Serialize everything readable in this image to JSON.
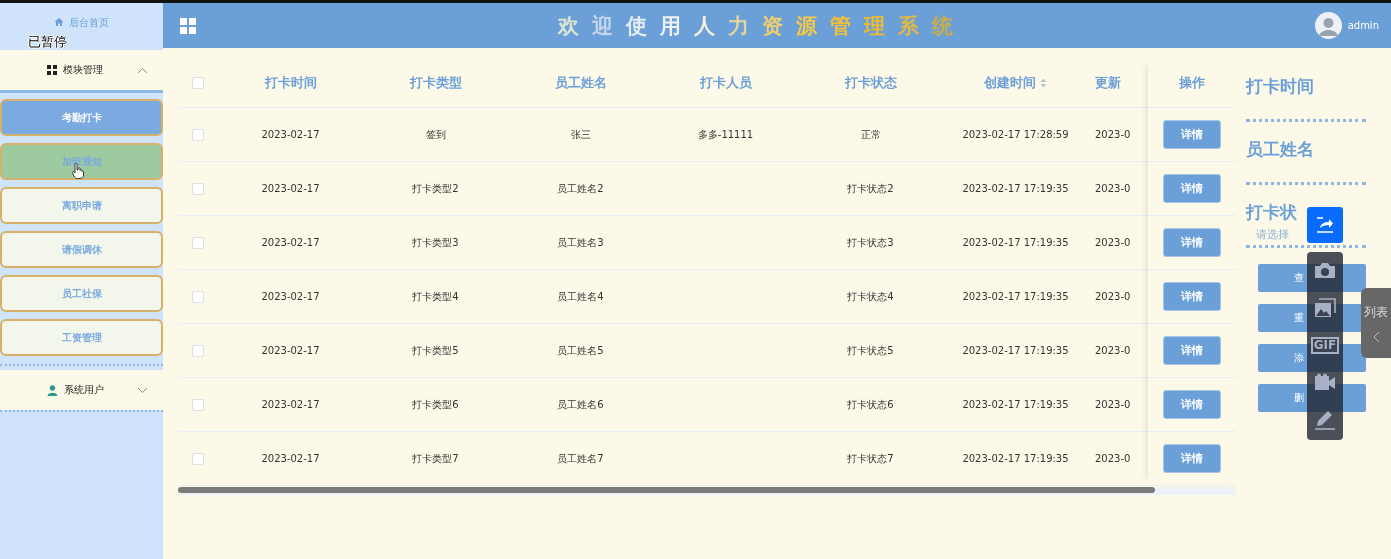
{
  "sidebar": {
    "home": "后台首页",
    "groups": [
      {
        "label": "模块管理",
        "expanded": true,
        "items": [
          {
            "label": "考勤打卡",
            "selected": true,
            "hovered": false
          },
          {
            "label": "加班通知",
            "selected": false,
            "hovered": true
          },
          {
            "label": "离职申请",
            "selected": false,
            "hovered": false
          },
          {
            "label": "请假调休",
            "selected": false,
            "hovered": false
          },
          {
            "label": "员工社保",
            "selected": false,
            "hovered": false
          },
          {
            "label": "工资管理",
            "selected": false,
            "hovered": false
          }
        ]
      },
      {
        "label": "系统用户",
        "expanded": false
      }
    ]
  },
  "header": {
    "title_chars": [
      {
        "char": "欢",
        "color": "#dbe4d4"
      },
      {
        "char": "迎",
        "color": "#c3d5ea"
      },
      {
        "char": "使",
        "color": "#e3ebf3"
      },
      {
        "char": "用",
        "color": "#eef2f5"
      },
      {
        "char": "人",
        "color": "#f2efe0"
      },
      {
        "char": "力",
        "color": "#e8d59a"
      },
      {
        "char": "资",
        "color": "#f0cf6a"
      },
      {
        "char": "源",
        "color": "#f4c64a"
      },
      {
        "char": "管",
        "color": "#f2bf3a"
      },
      {
        "char": "理",
        "color": "#eebc30"
      },
      {
        "char": "系",
        "color": "#e0b848"
      },
      {
        "char": "统",
        "color": "#c8ac50"
      }
    ],
    "user": "admin"
  },
  "table": {
    "header_checked": false,
    "columns": [
      {
        "label": "打卡时间"
      },
      {
        "label": "打卡类型"
      },
      {
        "label": "员工姓名"
      },
      {
        "label": "打卡人员"
      },
      {
        "label": "打卡状态"
      },
      {
        "label": "创建时间",
        "sortable": true
      },
      {
        "label": "更新"
      }
    ],
    "action_header": "操作",
    "rows": [
      {
        "checked": false,
        "cells": [
          "2023-02-17",
          "签到",
          "张三",
          "多多-11111",
          "正常",
          "2023-02-17 17:28:59",
          "2023-0"
        ],
        "action": "详情"
      },
      {
        "checked": false,
        "cells": [
          "2023-02-17",
          "打卡类型2",
          "员工姓名2",
          null,
          "打卡状态2",
          "2023-02-17 17:19:35",
          "2023-0"
        ],
        "action": "详情"
      },
      {
        "checked": false,
        "cells": [
          "2023-02-17",
          "打卡类型3",
          "员工姓名3",
          null,
          "打卡状态3",
          "2023-02-17 17:19:35",
          "2023-0"
        ],
        "action": "详情"
      },
      {
        "checked": false,
        "cells": [
          "2023-02-17",
          "打卡类型4",
          "员工姓名4",
          null,
          "打卡状态4",
          "2023-02-17 17:19:35",
          "2023-0"
        ],
        "action": "详情"
      },
      {
        "checked": false,
        "cells": [
          "2023-02-17",
          "打卡类型5",
          "员工姓名5",
          null,
          "打卡状态5",
          "2023-02-17 17:19:35",
          "2023-0"
        ],
        "action": "详情"
      },
      {
        "checked": false,
        "cells": [
          "2023-02-17",
          "打卡类型6",
          "员工姓名6",
          null,
          "打卡状态6",
          "2023-02-17 17:19:35",
          "2023-0"
        ],
        "action": "详情"
      },
      {
        "checked": false,
        "cells": [
          "2023-02-17",
          "打卡类型7",
          "员工姓名7",
          null,
          "打卡状态7",
          "2023-02-17 17:19:35",
          "2023-0"
        ],
        "action": "详情"
      }
    ]
  },
  "search": {
    "fields": [
      {
        "label": "打卡时间"
      },
      {
        "label": "员工姓名"
      },
      {
        "label": "打卡状",
        "placeholder": "请选择"
      }
    ],
    "buttons": [
      "查",
      "重",
      "添",
      "删"
    ]
  },
  "overlay": {
    "paused_label": "已暂停",
    "gif_label": "GIF",
    "side_tab": "列表"
  }
}
